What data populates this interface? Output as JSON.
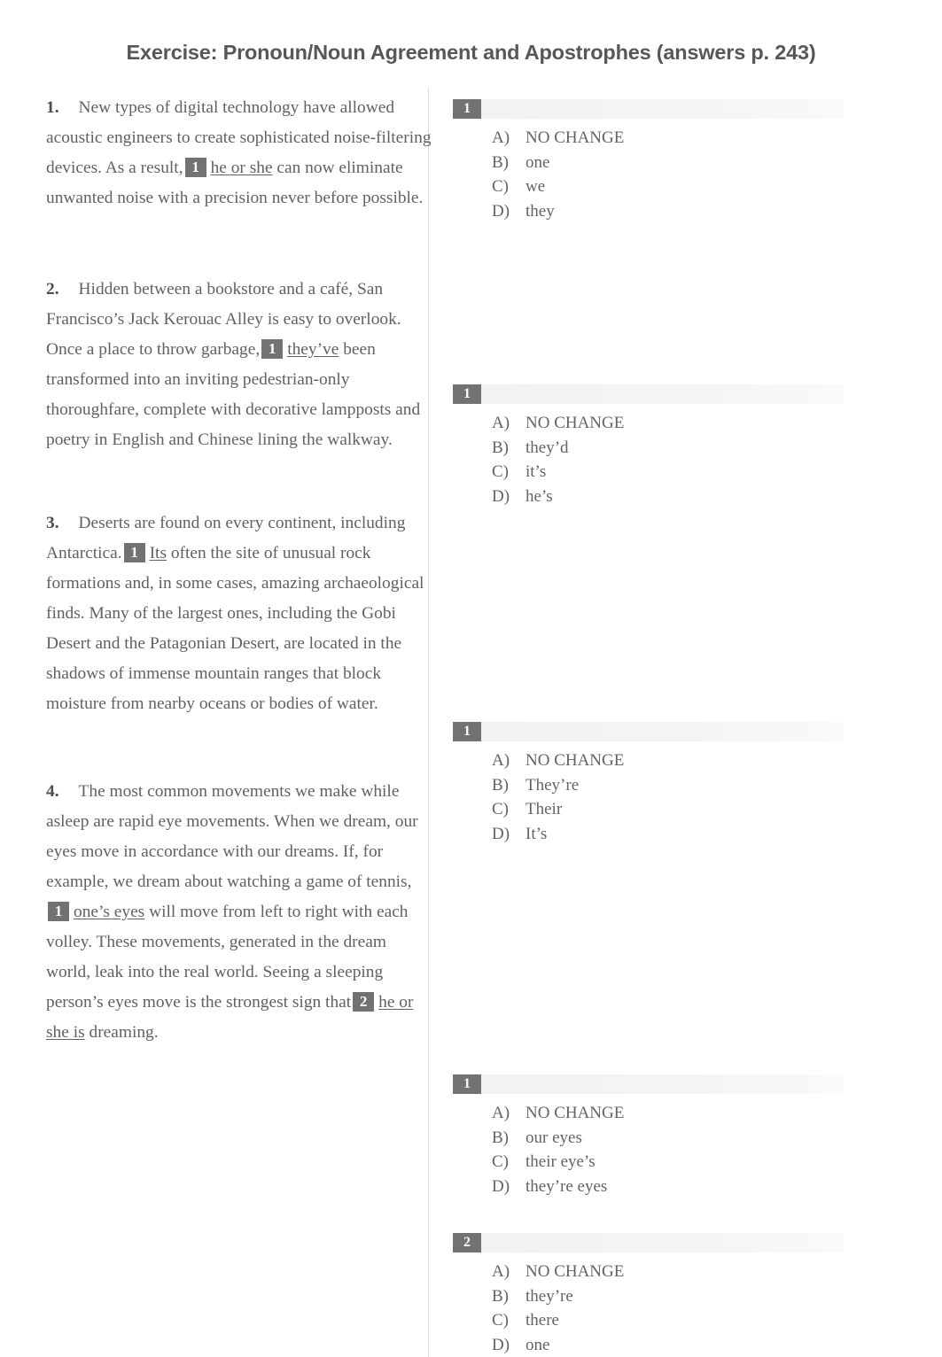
{
  "document": {
    "title": "Exercise: Pronoun/Noun Agreement and Apostrophes (answers p. 243)"
  },
  "questions": [
    {
      "number": "1.",
      "passage": {
        "before": "New types of digital technology have allowed acoustic engineers to create sophisticated noise-filtering devices. As a result,",
        "badge": "1",
        "underlined": "he or she",
        "after": "can now eliminate unwanted noise with a precision never before possible."
      }
    },
    {
      "number": "2.",
      "passage": {
        "before": "Hidden between a bookstore and a café, San Francisco’s Jack Kerouac Alley is easy to overlook. Once a place to throw garbage,",
        "badge": "1",
        "underlined": "they’ve",
        "after": "been transformed into an inviting pedestrian-only thoroughfare, complete with decorative lampposts and poetry in English and Chinese lining the walkway."
      }
    },
    {
      "number": "3.",
      "passage": {
        "before": "Deserts are found on every continent, including Antarctica.",
        "badge": "1",
        "underlined": "Its",
        "after": "often the site of unusual rock formations and, in some cases, amazing archaeological finds. Many of the largest ones, including the Gobi Desert and the Patagonian Desert, are located in the shadows of immense mountain ranges that block moisture from nearby oceans or bodies of water."
      }
    },
    {
      "number": "4.",
      "passage": {
        "before": "The most common movements we make while asleep are rapid eye movements. When we dream, our eyes move in accordance with our dreams. If, for example, we dream about watching a game of tennis,",
        "badge": "1",
        "underlined": "one’s eyes",
        "middle": "will move from left to right with each volley. These movements, generated in the dream world, leak into the real world. Seeing a sleeping person’s eyes move is the strongest sign that",
        "badge2": "2",
        "underlined2": "he or she is",
        "after": "dreaming."
      }
    }
  ],
  "answer_groups": [
    {
      "badge": "1",
      "choices": [
        {
          "letter": "A)",
          "text": "NO CHANGE"
        },
        {
          "letter": "B)",
          "text": "one"
        },
        {
          "letter": "C)",
          "text": "we"
        },
        {
          "letter": "D)",
          "text": "they"
        }
      ]
    },
    {
      "badge": "1",
      "choices": [
        {
          "letter": "A)",
          "text": "NO CHANGE"
        },
        {
          "letter": "B)",
          "text": "they’d"
        },
        {
          "letter": "C)",
          "text": "it’s"
        },
        {
          "letter": "D)",
          "text": "he’s"
        }
      ]
    },
    {
      "badge": "1",
      "choices": [
        {
          "letter": "A)",
          "text": "NO CHANGE"
        },
        {
          "letter": "B)",
          "text": "They’re"
        },
        {
          "letter": "C)",
          "text": "Their"
        },
        {
          "letter": "D)",
          "text": "It’s"
        }
      ]
    },
    {
      "badge": "1",
      "choices": [
        {
          "letter": "A)",
          "text": "NO CHANGE"
        },
        {
          "letter": "B)",
          "text": "our eyes"
        },
        {
          "letter": "C)",
          "text": "their eye’s"
        },
        {
          "letter": "D)",
          "text": "they’re eyes"
        }
      ]
    },
    {
      "badge": "2",
      "choices": [
        {
          "letter": "A)",
          "text": "NO CHANGE"
        },
        {
          "letter": "B)",
          "text": "they’re"
        },
        {
          "letter": "C)",
          "text": "there"
        },
        {
          "letter": "D)",
          "text": "one"
        }
      ]
    }
  ],
  "colors": {
    "badge_background": "#727272",
    "badge_text": "#ffffff",
    "header_bar": "#f2f2f2",
    "body_text": "#616161",
    "title_text": "#555759",
    "divider": "#dedede"
  }
}
